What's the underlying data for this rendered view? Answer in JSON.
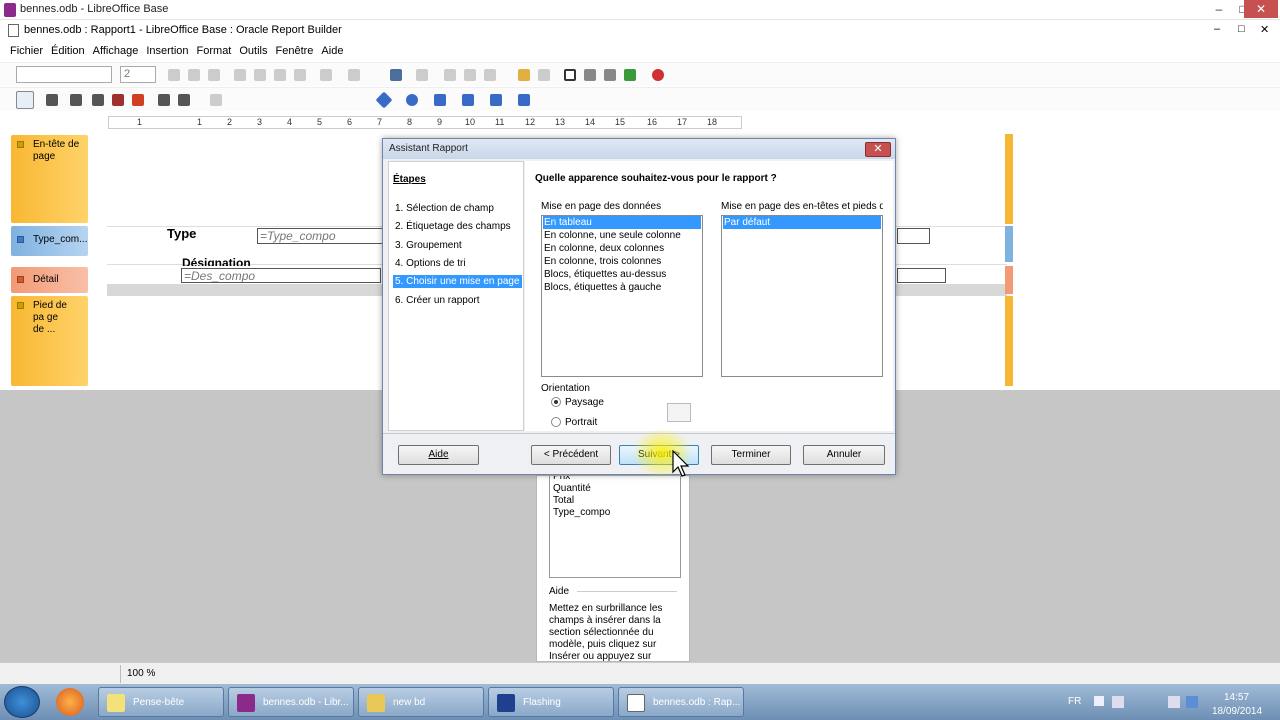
{
  "window": {
    "title": "bennes.odb - LibreOffice Base",
    "doc_title": "bennes.odb : Rapport1 - LibreOffice Base : Oracle Report Builder"
  },
  "menu": [
    "Fichier",
    "Édition",
    "Affichage",
    "Insertion",
    "Format",
    "Outils",
    "Fenêtre",
    "Aide"
  ],
  "toolbar": {
    "font_size": "2"
  },
  "ruler": [
    "1",
    "1",
    "2",
    "3",
    "4",
    "5",
    "6",
    "7",
    "8",
    "9",
    "10",
    "11",
    "12",
    "13",
    "14",
    "15",
    "16",
    "17",
    "18"
  ],
  "sections": [
    {
      "label": "En-tête de page"
    },
    {
      "label": "Type_com..."
    },
    {
      "label": "Détail"
    },
    {
      "label": "Pied de pa ge de ..."
    }
  ],
  "report": {
    "type_label": "Type",
    "type_field": "=Type_compo",
    "designation_label": "Désignation",
    "des_field": "=Des_compo"
  },
  "dialog": {
    "title": "Assistant Rapport",
    "steps_header": "Étapes",
    "steps": [
      "1. Sélection de champ",
      "2. Étiquetage des champs",
      "3. Groupement",
      "4. Options de tri",
      "5. Choisir une mise en page",
      "6. Créer un rapport"
    ],
    "question": "Quelle apparence souhaitez-vous pour le rapport ?",
    "data_layout_label": "Mise en page des données",
    "data_layouts": [
      "En tableau",
      "En colonne, une seule colonne",
      "En colonne, deux colonnes",
      "En colonne, trois colonnes",
      "Blocs, étiquettes au-dessus",
      "Blocs, étiquettes à gauche"
    ],
    "header_layout_label": "Mise en page des en-têtes et pieds de p",
    "header_layouts": [
      "Par défaut"
    ],
    "orientation_label": "Orientation",
    "orientation_options": [
      "Paysage",
      "Portrait"
    ],
    "orientation_selected": "Paysage",
    "buttons": {
      "help": "Aide",
      "prev": "< Précédent",
      "next": "Suivant >",
      "finish": "Terminer",
      "cancel": "Annuler"
    }
  },
  "field_panel": {
    "fields": [
      "Prix",
      "Quantité",
      "Total",
      "Type_compo"
    ],
    "help_title": "Aide",
    "help_text": "Mettez en surbrillance les champs à insérer dans la section sélectionnée du modèle, puis cliquez sur Insérer ou appuyez sur Entrée."
  },
  "status": {
    "zoom": "100 %"
  },
  "taskbar": {
    "items": [
      "Pense-bête",
      "bennes.odb - Libr...",
      "new bd",
      "Flashing",
      "bennes.odb : Rap..."
    ],
    "lang": "FR",
    "time": "14:57",
    "date": "18/09/2014"
  },
  "colors": {
    "section_orange": "#f8b732",
    "section_blue": "#7fb2e0",
    "section_salmon": "#f29a74",
    "selection": "#3399ff"
  }
}
